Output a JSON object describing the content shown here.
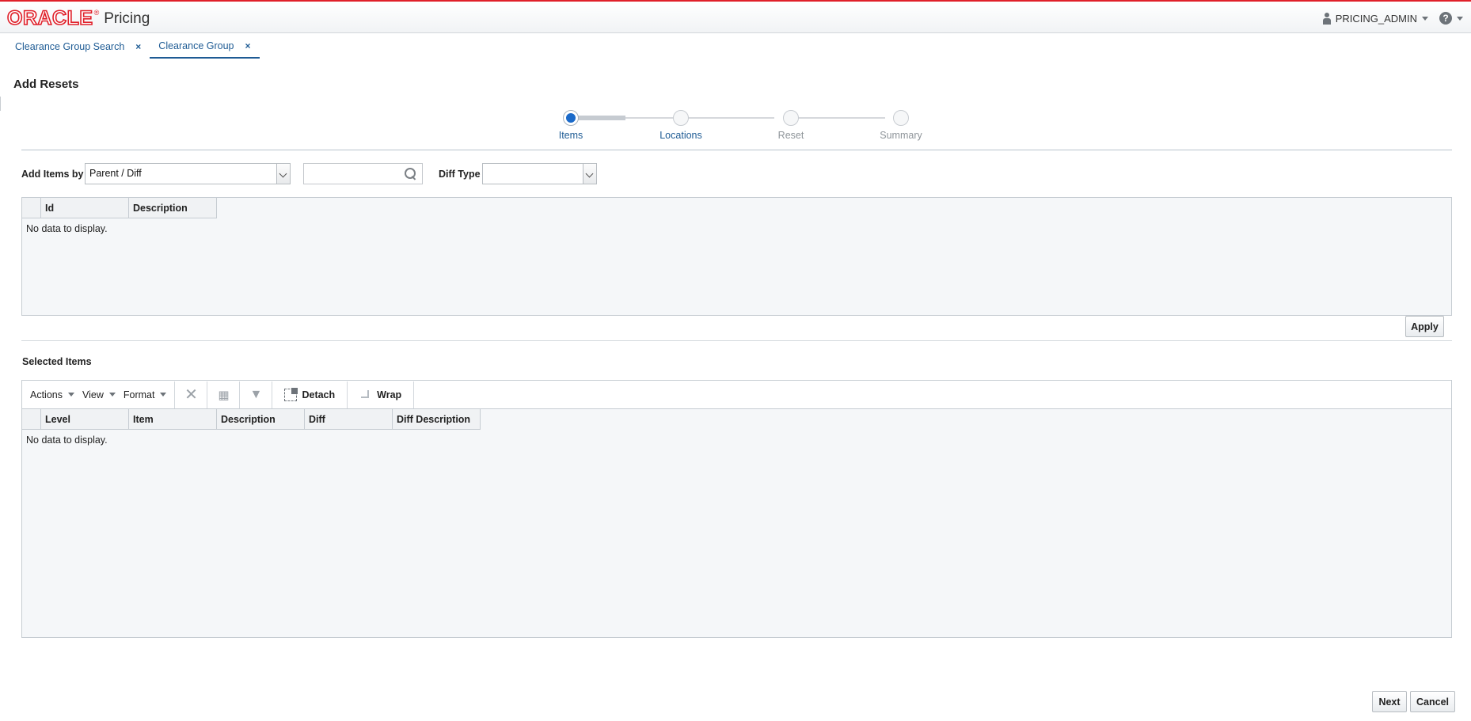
{
  "header": {
    "brand": "ORACLE",
    "registered": "®",
    "product": "Pricing",
    "user": "PRICING_ADMIN",
    "help_glyph": "?"
  },
  "tabs": [
    {
      "label": "Clearance Group Search",
      "close": "×",
      "active": false
    },
    {
      "label": "Clearance Group",
      "close": "×",
      "active": true
    }
  ],
  "page": {
    "title": "Add Resets"
  },
  "train": {
    "stops": [
      {
        "label": "Items",
        "state": "current"
      },
      {
        "label": "Locations",
        "state": "visited"
      },
      {
        "label": "Reset",
        "state": "disabled"
      },
      {
        "label": "Summary",
        "state": "disabled"
      }
    ]
  },
  "search": {
    "add_items_by_label": "Add Items by",
    "add_items_by_value": "Parent / Diff",
    "item_search_value": "",
    "diff_type_label": "Diff Type",
    "diff_type_value": ""
  },
  "results_table": {
    "columns": [
      "Id",
      "Description"
    ],
    "empty_text": "No data to display."
  },
  "apply_label": "Apply",
  "selected_items": {
    "title": "Selected Items",
    "toolbar": {
      "actions": "Actions",
      "view": "View",
      "format": "Format",
      "detach": "Detach",
      "wrap": "Wrap"
    },
    "columns": [
      "Level",
      "Item",
      "Description",
      "Diff",
      "Diff Description"
    ],
    "empty_text": "No data to display."
  },
  "footer": {
    "next_label": "Next",
    "cancel_label": "Cancel"
  },
  "colors": {
    "brand_red": "#e0202a",
    "link_blue": "#1e5b94",
    "train_current": "#1b6ac9"
  }
}
